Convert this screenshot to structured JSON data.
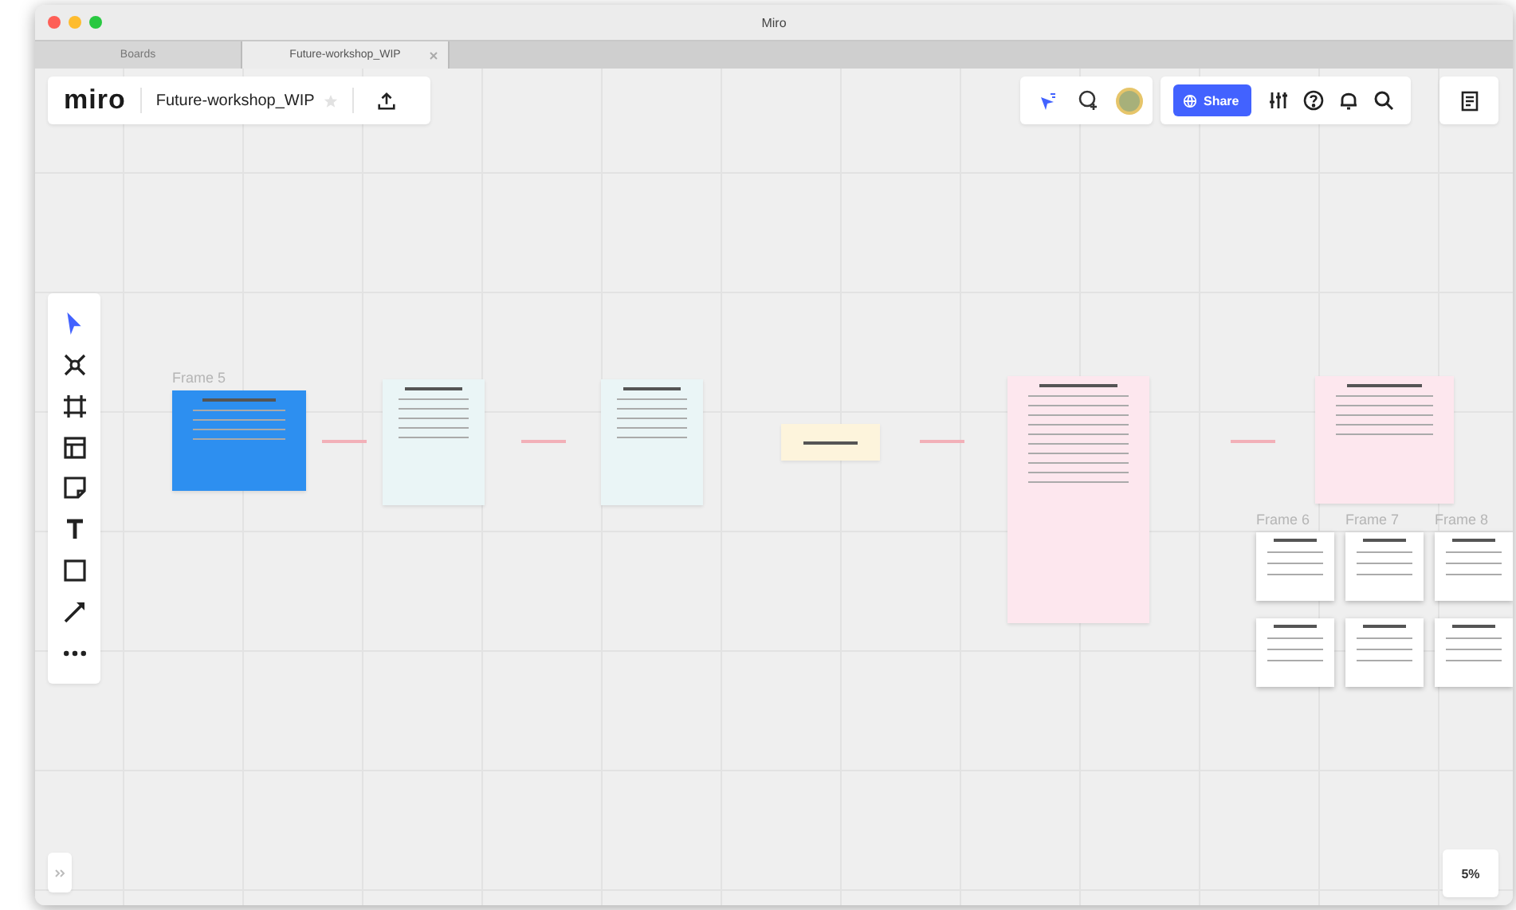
{
  "window": {
    "title": "Miro"
  },
  "tabs": [
    {
      "label": "Boards",
      "selected": false,
      "closable": false
    },
    {
      "label": "Future-workshop_WIP",
      "selected": true,
      "closable": true
    }
  ],
  "board": {
    "logo": "miro",
    "name": "Future-workshop_WIP",
    "starred": false
  },
  "topbar": {
    "share": "Share"
  },
  "tools": [
    {
      "kind": "select",
      "selected": true
    },
    {
      "kind": "mindmap",
      "selected": false
    },
    {
      "kind": "frame",
      "selected": false
    },
    {
      "kind": "template",
      "selected": false
    },
    {
      "kind": "sticky",
      "selected": false
    },
    {
      "kind": "text",
      "selected": false
    },
    {
      "kind": "shape",
      "selected": false
    },
    {
      "kind": "line",
      "selected": false
    },
    {
      "kind": "more",
      "selected": false
    }
  ],
  "canvas": {
    "items": [
      {
        "kind": "frame",
        "color": "#2d8ff0",
        "label": "Frame 5"
      },
      {
        "kind": "arrow"
      },
      {
        "kind": "frame",
        "color": "#eaf5f6"
      },
      {
        "kind": "arrow"
      },
      {
        "kind": "frame",
        "color": "#eaf5f6"
      },
      {
        "kind": "sticky",
        "color": "#fdf4dc"
      },
      {
        "kind": "arrow"
      },
      {
        "kind": "frame",
        "color": "#fde7ee"
      },
      {
        "kind": "arrow"
      },
      {
        "kind": "frame",
        "color": "#fde7ee"
      },
      {
        "kind": "card",
        "color": "#ffffff",
        "label": "Frame 6"
      },
      {
        "kind": "card",
        "color": "#ffffff",
        "label": "Frame 7"
      },
      {
        "kind": "card",
        "color": "#ffffff",
        "label": "Frame 8"
      },
      {
        "kind": "card",
        "color": "#ffffff"
      },
      {
        "kind": "card",
        "color": "#ffffff"
      },
      {
        "kind": "card",
        "color": "#ffffff"
      }
    ]
  },
  "zoom": "5%"
}
